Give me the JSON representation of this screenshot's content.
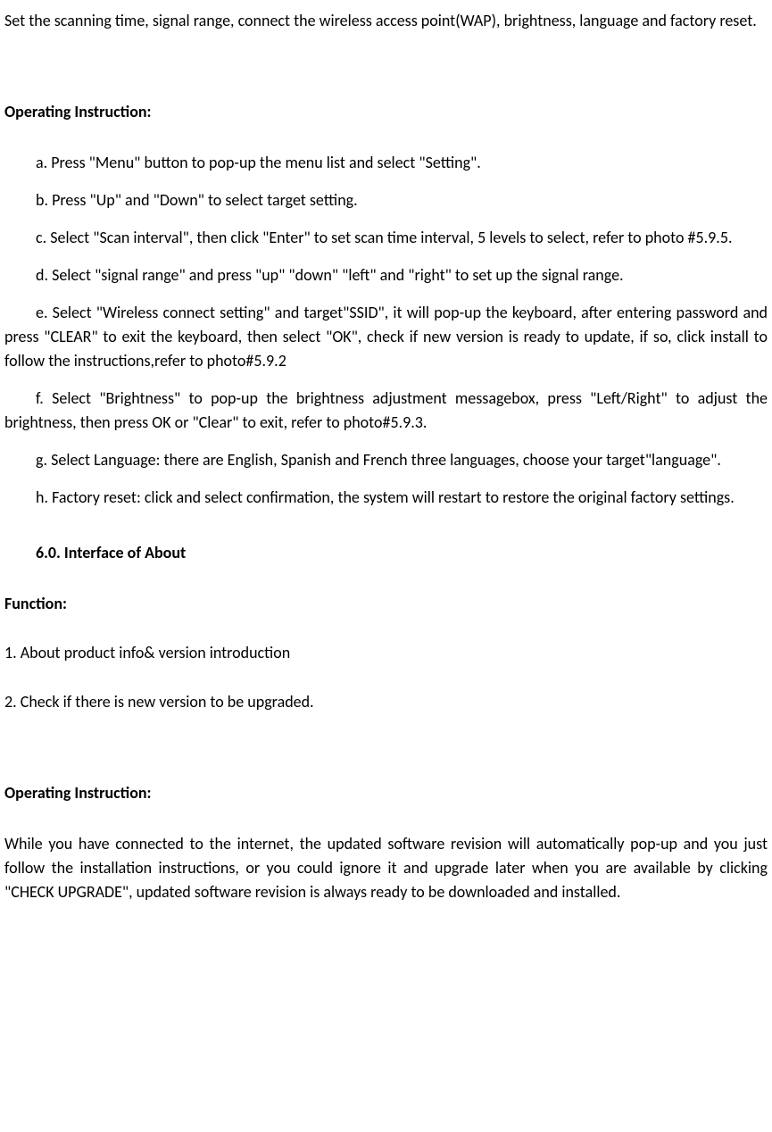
{
  "intro": "Set the scanning time, signal range, connect the wireless access point(WAP), brightness, language and factory reset.",
  "heading1": "Operating Instruction:",
  "steps": {
    "a": "a. Press \"Menu\" button to pop-up the menu list and select \"Setting\".",
    "b": "b. Press \"Up\" and \"Down\" to select target setting.",
    "c": "c. Select \"Scan interval\", then click \"Enter\" to set scan time interval, 5 levels to select, refer to photo #5.9.5.",
    "d": "d. Select \"signal range\" and press \"up\" \"down\" \"left\" and \"right\" to set up the signal range.",
    "e": "e. Select \"Wireless connect setting\" and target\"SSID\", it will pop-up the keyboard, after entering password and press \"CLEAR\" to exit the keyboard, then select \"OK\", check if new version is ready to update, if so, click install to follow the instructions,refer to photo#5.9.2",
    "f": "f. Select \"Brightness\" to pop-up the brightness adjustment messagebox, press \"Left/Right\" to adjust the brightness, then press OK or \"Clear\" to exit, refer to photo#5.9.3.",
    "g": "g. Select Language: there are English, Spanish and French three languages, choose your target\"language\".",
    "h": "h. Factory reset: click and select confirmation, the system will restart to restore the original factory settings."
  },
  "section_title": "6.0. Interface of About",
  "func_heading": "Function:",
  "func_items": {
    "1": "1. About product info& version introduction",
    "2": "2. Check if there is new version to be upgraded."
  },
  "heading2": "Operating Instruction:",
  "final": "While you have connected to the internet, the updated software revision will automatically pop-up and you just follow the installation instructions, or you could ignore it and upgrade later when you are available by clicking \"CHECK UPGRADE\", updated software revision is always ready to be downloaded and installed."
}
